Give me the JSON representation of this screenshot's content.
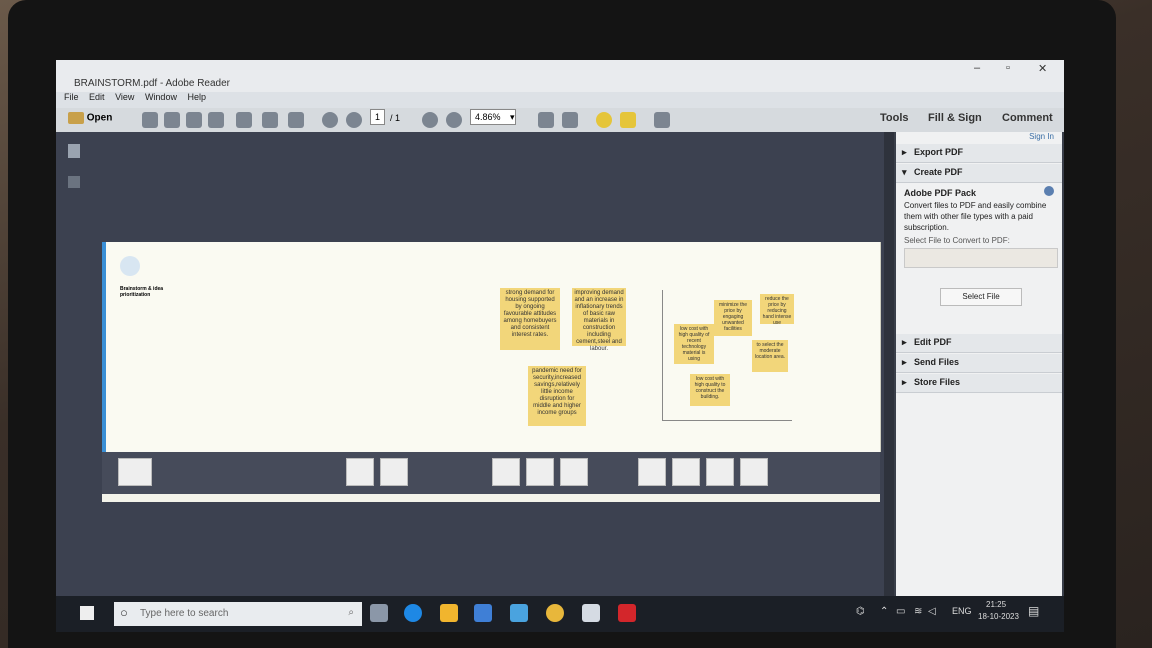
{
  "window": {
    "title": "BRAINSTORM.pdf - Adobe Reader"
  },
  "menu": [
    "File",
    "Edit",
    "View",
    "Window",
    "Help"
  ],
  "toolbar": {
    "open_label": "Open",
    "page_current": "1",
    "page_total": "/ 1",
    "zoom": "4.86%"
  },
  "tabs": [
    "Tools",
    "Fill & Sign",
    "Comment"
  ],
  "signin": "Sign In",
  "right_panel": {
    "export": "Export PDF",
    "create": "Create PDF",
    "pack_title": "Adobe PDF Pack",
    "pack_desc": "Convert files to PDF and easily combine them with other file types with a paid subscription.",
    "select_label": "Select File to Convert to PDF:",
    "select_button": "Select File",
    "edit": "Edit PDF",
    "send": "Send Files",
    "store": "Store Files"
  },
  "board": {
    "title": "Brainstorm & idea prioritization",
    "stickies": [
      "strong demand for housing supported by ongoing favourable attitudes among homebuyers and consistent interest rates.",
      "improving demand and an increase in inflationary trends of basic raw materials in construction including cement,steel and labour.",
      "pandemic need for security,increased savings,relatively little income disruption for middle and higher income groups",
      "low cost with high quality of recent technology material is using",
      "minimize the price by engaging unwanted facilities",
      "reduce the price by reducing hand intense use",
      "to select the moderate location area.",
      "low cost with high quality to construct the building."
    ]
  },
  "taskbar": {
    "search_placeholder": "Type here to search",
    "time": "21:25",
    "date": "18-10-2023",
    "lang": "ENG"
  }
}
